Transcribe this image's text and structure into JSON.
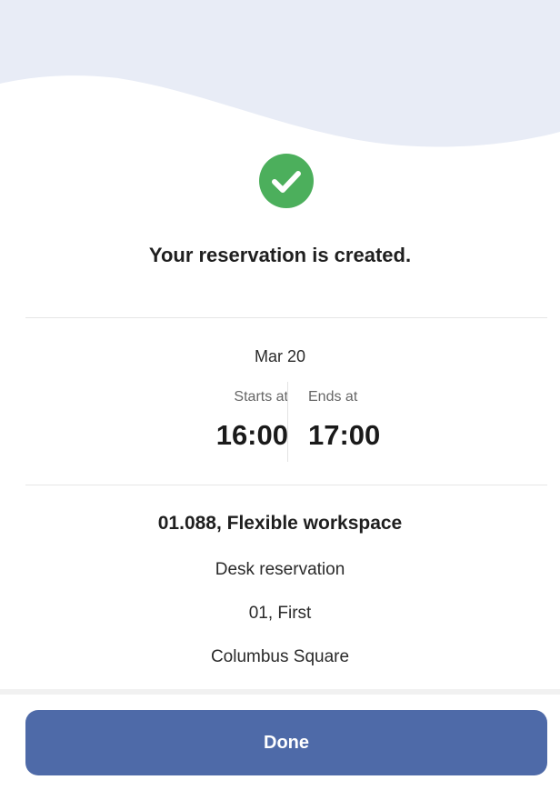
{
  "colors": {
    "header_wave": "#e8ecf6",
    "success_green": "#4caf5c",
    "button_bg": "#4e6aa8",
    "button_text": "#ffffff"
  },
  "confirmation": {
    "icon": "check-circle-icon",
    "message": "Your reservation is created."
  },
  "schedule": {
    "date": "Mar 20",
    "start_label": "Starts at",
    "start_time": "16:00",
    "end_label": "Ends at",
    "end_time": "17:00"
  },
  "details": {
    "title": "01.088, Flexible workspace",
    "type": "Desk reservation",
    "floor": "01, First",
    "building": "Columbus Square"
  },
  "actions": {
    "done_label": "Done"
  }
}
